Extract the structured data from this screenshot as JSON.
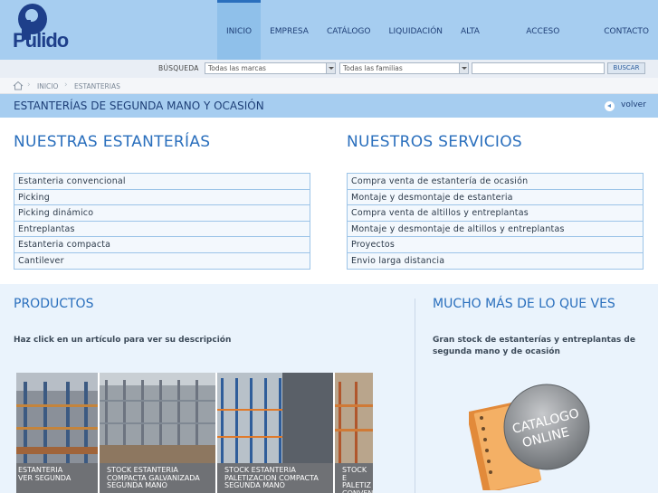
{
  "brand": {
    "logo_text": "Pulido"
  },
  "nav": {
    "items": [
      {
        "label": "INICIO",
        "active": true
      },
      {
        "label": "EMPRESA",
        "active": false
      },
      {
        "label": "CATÁLOGO",
        "active": false
      },
      {
        "label": "LIQUIDACIÓN",
        "active": false
      },
      {
        "label": "ALTA CLIENTE",
        "active": false
      },
      {
        "label": "ACCESO CLIENTE",
        "active": false
      },
      {
        "label": "CONTACTO",
        "active": false
      }
    ]
  },
  "search": {
    "label": "BÚSQUEDA",
    "brand_select": "Todas las marcas",
    "family_select": "Todas las familias",
    "input_value": "",
    "button": "BUSCAR"
  },
  "breadcrumb": {
    "icon": "home-icon",
    "items": [
      "INICIO",
      "ESTANTERIAS"
    ]
  },
  "page": {
    "title": "ESTANTERÍAS DE SEGUNDA MANO Y OCASIÓN",
    "back_label": "volver"
  },
  "estanterias": {
    "title": "NUESTRAS ESTANTERÍAS",
    "items": [
      "Estanteria convencional",
      "Picking",
      "Picking dinámico",
      "Entreplantas",
      "Estanteria compacta",
      "Cantilever"
    ]
  },
  "servicios": {
    "title": "NUESTROS SERVICIOS",
    "items": [
      "Compra venta de estantería de ocasión",
      "Montaje y desmontaje de estanteria",
      "Compra venta de altillos y entreplantas",
      "Montaje y desmontaje de altillos y entreplantas",
      "Proyectos",
      "Envio larga distancia"
    ]
  },
  "productos": {
    "title": "PRODUCTOS",
    "hint": "Haz click en un artículo para ver su descripción",
    "thumbs": [
      {
        "caption": "ESTANTERIA\nVER SEGUNDA"
      },
      {
        "caption": "STOCK ESTANTERIA COMPACTA GALVANIZADA SEGUNDA MANO"
      },
      {
        "caption": "STOCK ESTANTERIA PALETIZACION COMPACTA SEGUNDA MANO"
      },
      {
        "caption": "STOCK E PALETIZ CONVEN"
      }
    ]
  },
  "mucho": {
    "title": "MUCHO MÁS DE LO QUE VES",
    "text": "Gran stock de estanterías y entreplantas de segunda mano y de ocasión",
    "catalog_line1": "CATALOGO",
    "catalog_line2": "ONLINE"
  },
  "colors": {
    "header_bg": "#a6cdf0",
    "accent": "#2a6fbd",
    "list_border": "#9cc4e8",
    "bottom_bg": "#eaf3fc"
  }
}
